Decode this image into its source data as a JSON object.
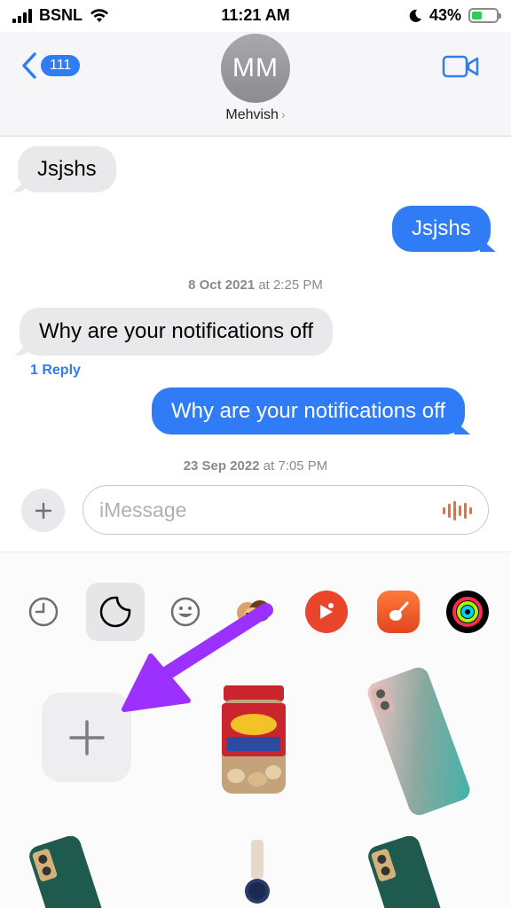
{
  "status_bar": {
    "carrier": "BSNL",
    "time": "11:21 AM",
    "battery": "43%",
    "battery_level": 0.43
  },
  "header": {
    "back_count": "111",
    "avatar_initials": "MM",
    "contact_name": "Mehvish"
  },
  "messages": [
    {
      "text": "Jsjshs",
      "from": "them"
    },
    {
      "text": "Jsjshs",
      "from": "me"
    },
    {
      "text": "Why are your notifications off",
      "from": "them"
    },
    {
      "text": "Why are your notifications off",
      "from": "me"
    }
  ],
  "timestamps": [
    {
      "date": "8 Oct 2021",
      "time": "at 2:25 PM"
    },
    {
      "date": "23 Sep 2022",
      "time": "at 7:05 PM"
    }
  ],
  "reply_link": "1 Reply",
  "composer": {
    "placeholder": "iMessage"
  },
  "app_drawer": {
    "apps": [
      "recents-icon",
      "stickers-icon",
      "emoji-icon",
      "memoji-icon",
      "youtube-music-icon",
      "garageband-icon",
      "fitness-icon"
    ],
    "accent_colors": {
      "blue": "#2f7cf6",
      "annotation_arrow": "#9b30ff"
    }
  }
}
